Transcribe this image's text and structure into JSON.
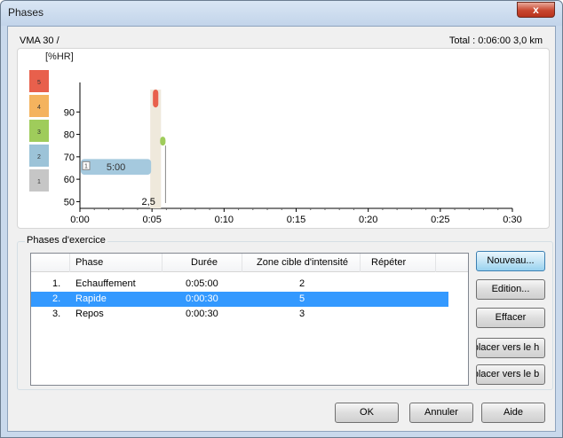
{
  "window": {
    "title": "Phases",
    "close_label": "x"
  },
  "header": {
    "left_text": "VMA 30  /",
    "right_text": "Total : 0:06:00   3,0 km"
  },
  "chart_data": {
    "type": "bar",
    "ylabel": "[%HR]",
    "y_ticks": [
      "50",
      "60",
      "70",
      "80",
      "90"
    ],
    "ylim": [
      47,
      100
    ],
    "x_ticks": [
      "0:00",
      "0:05",
      "0:10",
      "0:15",
      "0:20",
      "0:25",
      "0:30"
    ],
    "xlim_minutes": [
      0,
      30
    ],
    "zones": [
      {
        "label": "5",
        "color": "#e8604c"
      },
      {
        "label": "4",
        "color": "#f4b35e"
      },
      {
        "label": "3",
        "color": "#9fcc5b"
      },
      {
        "label": "2",
        "color": "#9cc3d8"
      },
      {
        "label": "1",
        "color": "#c6c6c6"
      }
    ],
    "phases": [
      {
        "start_min": 0,
        "end_min": 5,
        "y_low": 62,
        "y_high": 69,
        "color": "#a5c9de",
        "label": "5:00",
        "index_label": "1"
      },
      {
        "start_min": 5,
        "end_min": 5.5,
        "y_low": 92,
        "y_high": 100,
        "color": "#e8604c",
        "label": "",
        "index_label": ""
      },
      {
        "start_min": 5.5,
        "end_min": 6,
        "y_low": 75,
        "y_high": 79,
        "color": "#9fcc5b",
        "label": "",
        "index_label": ""
      }
    ],
    "distance_label": "2,5"
  },
  "phases_group": {
    "label": "Phases d'exercice"
  },
  "table": {
    "columns": [
      "",
      "Phase",
      "Durée",
      "Zone cible d'intensité",
      "Répéter"
    ],
    "rows": [
      {
        "num": "1.",
        "phase": "Echauffement",
        "duree": "0:05:00",
        "zone": "2",
        "repeter": "",
        "selected": false
      },
      {
        "num": "2.",
        "phase": "Rapide",
        "duree": "0:00:30",
        "zone": "5",
        "repeter": "",
        "selected": true
      },
      {
        "num": "3.",
        "phase": "Repos",
        "duree": "0:00:30",
        "zone": "3",
        "repeter": "",
        "selected": false
      }
    ]
  },
  "buttons": {
    "nouveau": "Nouveau...",
    "edition": "Edition...",
    "effacer": "Effacer",
    "deplacer_haut": "placer vers le h",
    "deplacer_bas": "placer vers le b",
    "ok": "OK",
    "annuler": "Annuler",
    "aide": "Aide"
  }
}
